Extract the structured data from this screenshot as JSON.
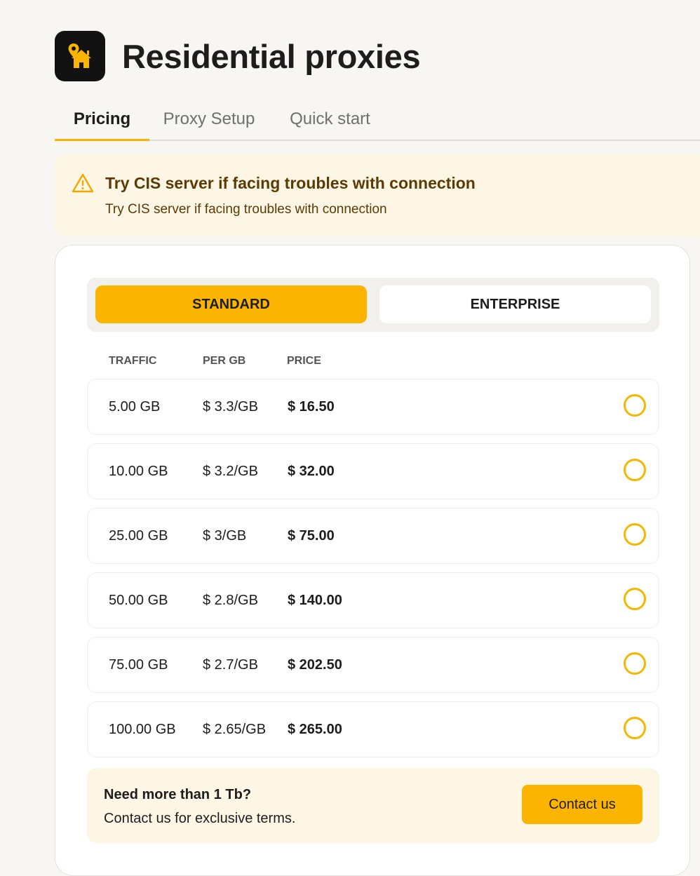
{
  "header": {
    "title": "Residential proxies",
    "icon": "home-location-icon"
  },
  "tabs": [
    {
      "label": "Pricing",
      "active": true
    },
    {
      "label": "Proxy Setup",
      "active": false
    },
    {
      "label": "Quick start",
      "active": false
    }
  ],
  "alert": {
    "icon": "warning-icon",
    "title": "Try CIS server if facing troubles with connection",
    "text": "Try CIS server if facing troubles with connection"
  },
  "plan_toggle": {
    "standard_label": "STANDARD",
    "enterprise_label": "ENTERPRISE",
    "selected": "STANDARD"
  },
  "table": {
    "headers": {
      "traffic": "TRAFFIC",
      "per_gb": "PER GB",
      "price": "PRICE"
    },
    "rows": [
      {
        "traffic": "5.00 GB",
        "per_gb": "$ 3.3/GB",
        "price": "$ 16.50",
        "selected": false
      },
      {
        "traffic": "10.00 GB",
        "per_gb": "$ 3.2/GB",
        "price": "$ 32.00",
        "selected": false
      },
      {
        "traffic": "25.00 GB",
        "per_gb": "$ 3/GB",
        "price": "$ 75.00",
        "selected": false
      },
      {
        "traffic": "50.00 GB",
        "per_gb": "$ 2.8/GB",
        "price": "$ 140.00",
        "selected": false
      },
      {
        "traffic": "75.00 GB",
        "per_gb": "$ 2.7/GB",
        "price": "$ 202.50",
        "selected": false
      },
      {
        "traffic": "100.00 GB",
        "per_gb": "$ 2.65/GB",
        "price": "$ 265.00",
        "selected": false
      }
    ]
  },
  "cta": {
    "title": "Need more than 1 Tb?",
    "text": "Contact us for exclusive terms.",
    "button_label": "Contact us"
  },
  "colors": {
    "accent": "#fbb400",
    "alert_bg": "#fdf6e4",
    "alert_text": "#5a3a05",
    "page_bg": "#f7f6f2"
  }
}
